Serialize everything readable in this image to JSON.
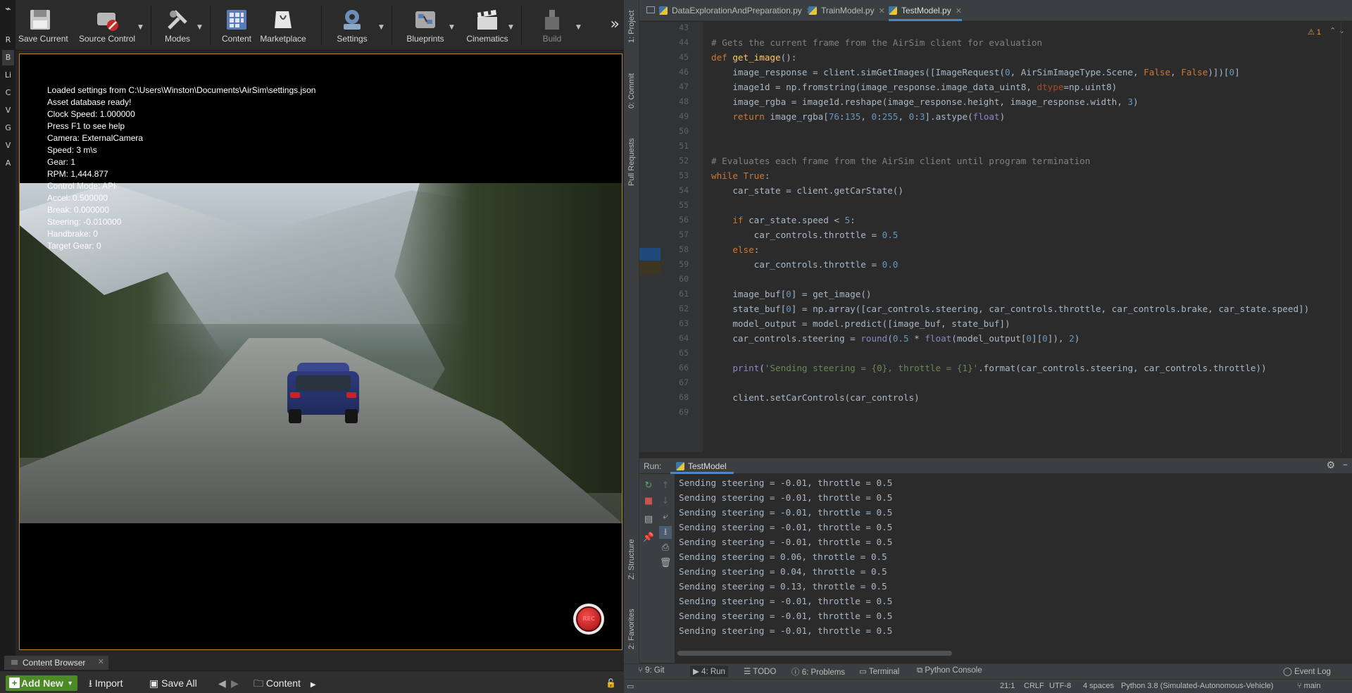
{
  "unreal": {
    "left_tabs": [
      "R",
      "B",
      "Li",
      "C",
      "V",
      "G",
      "V",
      "A"
    ],
    "toolbar": [
      {
        "label": "Save Current",
        "icon": "save-icon"
      },
      {
        "label": "Source Control",
        "icon": "source-control-icon"
      },
      {
        "label": "Modes",
        "icon": "modes-icon"
      },
      {
        "label": "Content",
        "icon": "content-icon"
      },
      {
        "label": "Marketplace",
        "icon": "marketplace-icon"
      },
      {
        "label": "Settings",
        "icon": "settings-icon"
      },
      {
        "label": "Blueprints",
        "icon": "blueprints-icon"
      },
      {
        "label": "Cinematics",
        "icon": "cinematics-icon"
      },
      {
        "label": "Build",
        "icon": "build-icon"
      }
    ],
    "hud": [
      "Loaded settings from C:\\Users\\Winston\\Documents\\AirSim\\settings.json",
      "Asset database ready!",
      "Clock Speed: 1.000000",
      "Press F1 to see help",
      "Camera: ExternalCamera",
      "Speed: 3 m\\s",
      "Gear: 1",
      "RPM: 1,444.877",
      "Control Mode: API",
      "Accel: 0.500000",
      "Break: 0.000000",
      "Steering: -0.010000",
      "Handbrake: 0",
      "Target Gear: 0"
    ],
    "rec_label": "REC",
    "content_browser": {
      "tab_label": "Content Browser",
      "add_new": "Add New",
      "import": "Import",
      "save_all": "Save All",
      "path": "Content"
    }
  },
  "pycharm": {
    "side_tabs": [
      "1: Project",
      "0: Commit",
      "Pull Requests",
      "Z: Structure",
      "2: Favorites"
    ],
    "file_tabs": [
      {
        "label": "DataExplorationAndPreparation.py",
        "active": false
      },
      {
        "label": "TrainModel.py",
        "active": false
      },
      {
        "label": "TestModel.py",
        "active": true
      }
    ],
    "warning_count": "1",
    "code_lines": [
      {
        "n": "43",
        "html": ""
      },
      {
        "n": "44",
        "html": "<span class=\"cm\"># Gets the current frame from the AirSim client for evaluation</span>"
      },
      {
        "n": "45",
        "html": "<span class=\"kw\">def </span><span class=\"fn\">get_image</span>():"
      },
      {
        "n": "46",
        "html": "    image_response = client.simGetImages([ImageRequest(<span class=\"nm\">0</span>, AirSimImageType.Scene, <span class=\"kw\">False</span>, <span class=\"kw\">False</span>)])[<span class=\"nm\">0</span>]"
      },
      {
        "n": "47",
        "html": "    image1d = np.fromstring(image_response.image_data_uint8, <span class=\"pa\">dtype</span>=np.uint8)"
      },
      {
        "n": "48",
        "html": "    image_rgba = image1d.reshape(image_response.height, image_response.width, <span class=\"nm\">3</span>)"
      },
      {
        "n": "49",
        "html": "    <span class=\"kw\">return </span>image_rgba[<span class=\"nm\">76</span>:<span class=\"nm\">135</span>, <span class=\"nm\">0</span>:<span class=\"nm\">255</span>, <span class=\"nm\">0</span>:<span class=\"nm\">3</span>].astype(<span class=\"bi\">float</span>)"
      },
      {
        "n": "50",
        "html": ""
      },
      {
        "n": "51",
        "html": ""
      },
      {
        "n": "52",
        "html": "<span class=\"cm\"># Evaluates each frame from the AirSim client until program termination</span>"
      },
      {
        "n": "53",
        "html": "<span class=\"kw\">while True</span>:"
      },
      {
        "n": "54",
        "html": "    car_state = client.getCarState()"
      },
      {
        "n": "55",
        "html": ""
      },
      {
        "n": "56",
        "html": "    <span class=\"kw\">if </span>car_state.speed &lt; <span class=\"nm\">5</span>:"
      },
      {
        "n": "57",
        "html": "        car_controls.throttle = <span class=\"nm\">0.5</span>"
      },
      {
        "n": "58",
        "html": "    <span class=\"kw\">else</span>:"
      },
      {
        "n": "59",
        "html": "        car_controls.throttle = <span class=\"nm\">0.0</span>"
      },
      {
        "n": "60",
        "html": ""
      },
      {
        "n": "61",
        "html": "    image_buf[<span class=\"nm\">0</span>] = get_image()"
      },
      {
        "n": "62",
        "html": "    state_buf[<span class=\"nm\">0</span>] = np.array([car_controls.steering, car_controls.throttle, car_controls.brake, car_state.speed])"
      },
      {
        "n": "63",
        "html": "    model_output = model.predict([image_buf, state_buf])"
      },
      {
        "n": "64",
        "html": "    car_controls.steering = <span class=\"bi\">round</span>(<span class=\"nm\">0.5</span> * <span class=\"bi\">float</span>(model_output[<span class=\"nm\">0</span>][<span class=\"nm\">0</span>]), <span class=\"nm\">2</span>)"
      },
      {
        "n": "65",
        "html": ""
      },
      {
        "n": "66",
        "html": "    <span class=\"bi\">print</span>(<span class=\"st\">'Sending steering = {0}, throttle = {1}'</span>.format(car_controls.steering, car_controls.throttle))"
      },
      {
        "n": "67",
        "html": ""
      },
      {
        "n": "68",
        "html": "    client.setCarControls(car_controls)"
      },
      {
        "n": "69",
        "html": ""
      }
    ],
    "run": {
      "label": "Run:",
      "tab": "TestModel",
      "output": [
        "Sending steering = -0.01, throttle = 0.5",
        "Sending steering = -0.01, throttle = 0.5",
        "Sending steering = -0.01, throttle = 0.5",
        "Sending steering = -0.01, throttle = 0.5",
        "Sending steering = -0.01, throttle = 0.5",
        "Sending steering = 0.06, throttle = 0.5",
        "Sending steering = 0.04, throttle = 0.5",
        "Sending steering = 0.13, throttle = 0.5",
        "Sending steering = -0.01, throttle = 0.5",
        "Sending steering = -0.01, throttle = 0.5",
        "Sending steering = -0.01, throttle = 0.5"
      ]
    },
    "bottom_tabs": [
      {
        "label": "9: Git",
        "icon": "git-icon"
      },
      {
        "label": "4: Run",
        "icon": "run-icon",
        "active": true
      },
      {
        "label": "TODO",
        "icon": "todo-icon"
      },
      {
        "label": "6: Problems",
        "icon": "problems-icon"
      },
      {
        "label": "Terminal",
        "icon": "terminal-icon"
      },
      {
        "label": "Python Console",
        "icon": "python-console-icon"
      }
    ],
    "event_log": "Event Log",
    "status": {
      "position": "21:1",
      "line_sep": "CRLF",
      "encoding": "UTF-8",
      "indent": "4 spaces",
      "interpreter": "Python 3.8 (Simulated-Autonomous-Vehicle)",
      "branch": "main"
    }
  }
}
